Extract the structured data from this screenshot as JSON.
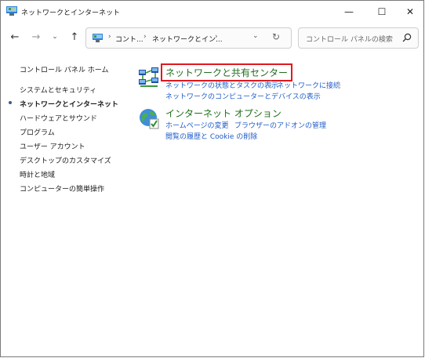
{
  "window": {
    "title": "ネットワークとインターネット",
    "minimize_glyph": "—",
    "maximize_glyph": "☐",
    "close_glyph": "✕"
  },
  "nav": {
    "back_glyph": "←",
    "forward_glyph": "→",
    "recent_glyph": "⌄",
    "up_glyph": "↑"
  },
  "address": {
    "crumbs": [
      "コント...",
      "ネットワークとイン...",
      ""
    ],
    "separator": "›",
    "dropdown_glyph": "⌄",
    "refresh_glyph": "↻"
  },
  "search": {
    "placeholder": "コントロール パネルの検索"
  },
  "sidebar": {
    "items": [
      {
        "label": "コントロール パネル ホーム"
      },
      {
        "label": "システムとセキュリティ"
      },
      {
        "label": "ネットワークとインターネット",
        "active": true
      },
      {
        "label": "ハードウェアとサウンド"
      },
      {
        "label": "プログラム"
      },
      {
        "label": "ユーザー アカウント"
      },
      {
        "label": "デスクトップのカスタマイズ"
      },
      {
        "label": "時計と地域"
      },
      {
        "label": "コンピューターの簡単操作"
      }
    ]
  },
  "categories": [
    {
      "title": "ネットワークと共有センター",
      "icon": "network-center-icon",
      "links": [
        "ネットワークの状態とタスクの表示",
        "ネットワークに接続",
        "ネットワークのコンピューターとデバイスの表示"
      ]
    },
    {
      "title": "インターネット オプション",
      "icon": "internet-options-icon",
      "links": [
        "ホームページの変更",
        "ブラウザーのアドオンの管理",
        "閲覧の履歴と Cookie の削除"
      ]
    }
  ],
  "colors": {
    "category_title": "#1e6e1e",
    "link": "#1e5bc8",
    "highlight_box": "#e0191e"
  }
}
